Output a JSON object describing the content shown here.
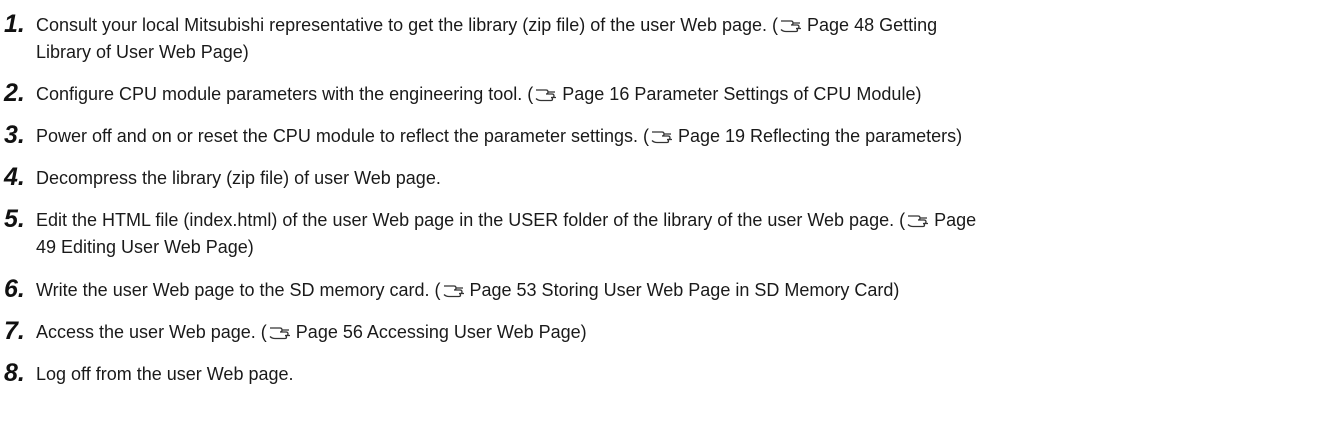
{
  "steps": [
    {
      "number": "1.",
      "text": "Consult your local Mitsubishi representative to get the library (zip file) of the user Web page. (",
      "ref_icon": "reference-hand-icon",
      "ref": "Page 48 Getting Library of User Web Page",
      "ref_lines": [
        "Page 48 Getting",
        "Library of User Web Page"
      ],
      "close": ")"
    },
    {
      "number": "2.",
      "text": "Configure CPU module parameters with the engineering tool. (",
      "ref_icon": "reference-hand-icon",
      "ref": "Page 16 Parameter Settings of CPU Module",
      "close": ")"
    },
    {
      "number": "3.",
      "text": "Power off and on or reset the CPU module to reflect the parameter settings. (",
      "ref_icon": "reference-hand-icon",
      "ref": "Page 19 Reflecting the parameters",
      "close": ")"
    },
    {
      "number": "4.",
      "text": "Decompress the library (zip file) of user Web page."
    },
    {
      "number": "5.",
      "text": "Edit the HTML file (index.html) of the user Web page in the USER folder of the library of the user Web page. (",
      "ref_icon": "reference-hand-icon",
      "ref": "Page 49 Editing User Web Page",
      "ref_lines": [
        "Page",
        "49 Editing User Web Page"
      ],
      "close": ")"
    },
    {
      "number": "6.",
      "text": "Write the user Web page to the SD memory card. (",
      "ref_icon": "reference-hand-icon",
      "ref": "Page 53 Storing User Web Page in SD Memory Card",
      "close": ")"
    },
    {
      "number": "7.",
      "text": "Access the user Web page. (",
      "ref_icon": "reference-hand-icon",
      "ref": "Page 56 Accessing User Web Page",
      "close": ")"
    },
    {
      "number": "8.",
      "text": "Log off from the user Web page."
    }
  ]
}
